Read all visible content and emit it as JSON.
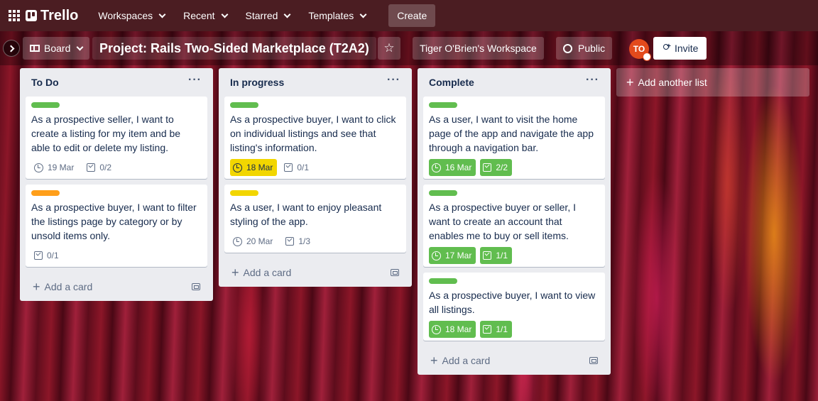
{
  "topbar": {
    "logo_text": "Trello",
    "nav": [
      "Workspaces",
      "Recent",
      "Starred",
      "Templates"
    ],
    "create_label": "Create"
  },
  "boardbar": {
    "view_label": "Board",
    "title": "Project: Rails Two-Sided Marketplace (T2A2)",
    "workspace_label": "Tiger O'Brien's Workspace",
    "visibility_label": "Public",
    "avatar_initials": "TO",
    "invite_label": "Invite"
  },
  "colors": {
    "green": "#61bd4f",
    "yellow": "#f2d600",
    "orange": "#ff9f1a",
    "topbar": "#4b1d22"
  },
  "lists": [
    {
      "title": "To Do",
      "add_card_label": "Add a card",
      "cards": [
        {
          "label_color": "green",
          "text": "As a prospective seller, I want to create a listing for my item and be able to edit or delete my listing.",
          "due": "19 Mar",
          "due_style": "plain",
          "checklist": "0/2",
          "check_style": "plain"
        },
        {
          "label_color": "orange",
          "text": "As a prospective buyer, I want to filter the listings page by category or by unsold items only.",
          "due": "",
          "due_style": "none",
          "checklist": "0/1",
          "check_style": "plain"
        }
      ]
    },
    {
      "title": "In progress",
      "add_card_label": "Add a card",
      "cards": [
        {
          "label_color": "green",
          "text": "As a prospective buyer, I want to click on individual listings and see that listing's information.",
          "due": "18 Mar",
          "due_style": "yellow",
          "checklist": "0/1",
          "check_style": "plain"
        },
        {
          "label_color": "yellow",
          "text": "As a user, I want to enjoy pleasant styling of the app.",
          "due": "20 Mar",
          "due_style": "plain",
          "checklist": "1/3",
          "check_style": "plain"
        }
      ]
    },
    {
      "title": "Complete",
      "add_card_label": "Add a card",
      "cards": [
        {
          "label_color": "green",
          "text": "As a user, I want to visit the home page of the app and navigate the app through a navigation bar.",
          "due": "16 Mar",
          "due_style": "green",
          "checklist": "2/2",
          "check_style": "green"
        },
        {
          "label_color": "green",
          "text": "As a prospective buyer or seller, I want to create an account that enables me to buy or sell items.",
          "due": "17 Mar",
          "due_style": "green",
          "checklist": "1/1",
          "check_style": "green"
        },
        {
          "label_color": "green",
          "text": "As a prospective buyer, I want to view all listings.",
          "due": "18 Mar",
          "due_style": "green",
          "checklist": "1/1",
          "check_style": "green"
        }
      ]
    }
  ],
  "add_list_label": "Add another list"
}
